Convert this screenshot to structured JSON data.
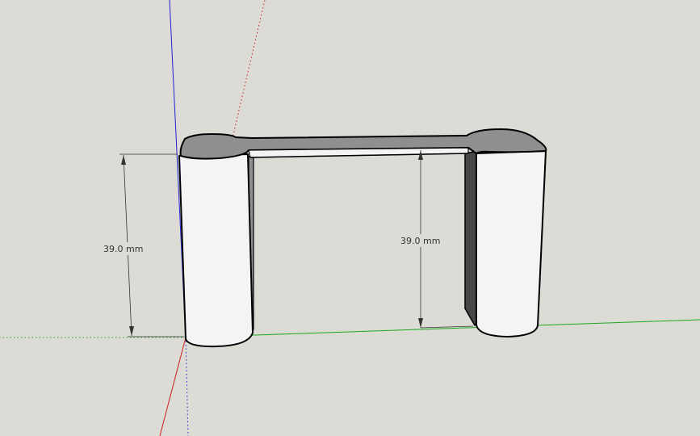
{
  "dimensions": {
    "left_label": "39.0 mm",
    "right_label": "39.0 mm"
  },
  "colors": {
    "background": "#dcdbd6",
    "face_light": "#f4f4f4",
    "face_shaded": "#8f8f8f",
    "face_dark": "#474747",
    "edge": "#000000",
    "axis_red": "#cc1f1f",
    "axis_green": "#1fa81f",
    "axis_blue": "#2323d0"
  }
}
